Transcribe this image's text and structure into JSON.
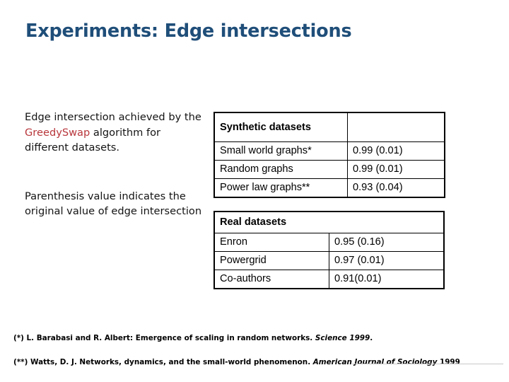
{
  "slide": {
    "title": "Experiments: Edge intersections",
    "title_color": "#1F4E79"
  },
  "left_text": {
    "paragraph_1": {
      "before_term": "Edge intersection achieved by the ",
      "term": "GreedySwap",
      "term_color": "#B8373C",
      "after_term": " algorithm for different datasets."
    },
    "paragraph_2": "Parenthesis value indicates the original value of edge intersection"
  },
  "tables": {
    "synthetic": {
      "section_label": "Synthetic datasets",
      "section_value": "",
      "rows": [
        {
          "label": "Small world graphs*",
          "value": "0.99 (0.01)"
        },
        {
          "label": "Random graphs",
          "value": "0.99 (0.01)"
        },
        {
          "label": "Power law graphs**",
          "value": "0.93 (0.04)"
        }
      ]
    },
    "real": {
      "section_label": "Real datasets",
      "rows": [
        {
          "label": "Enron",
          "value": "0.95 (0.16)"
        },
        {
          "label": "Powergrid",
          "value": "0.97 (0.01)"
        },
        {
          "label": "Co-authors",
          "value": "0.91(0.01)"
        }
      ]
    }
  },
  "footnotes": {
    "one": {
      "marker_and_text": "(*) L. Barabasi and R. Albert: Emergence of  scaling in random networks. ",
      "journal": "Science 1999",
      "tail": "."
    },
    "two": {
      "marker_and_text": "(**) Watts, D. J. Networks, dynamics, and the small-world phenomenon. ",
      "journal": "American Journal of Sociology",
      "tail": " 1999"
    }
  }
}
